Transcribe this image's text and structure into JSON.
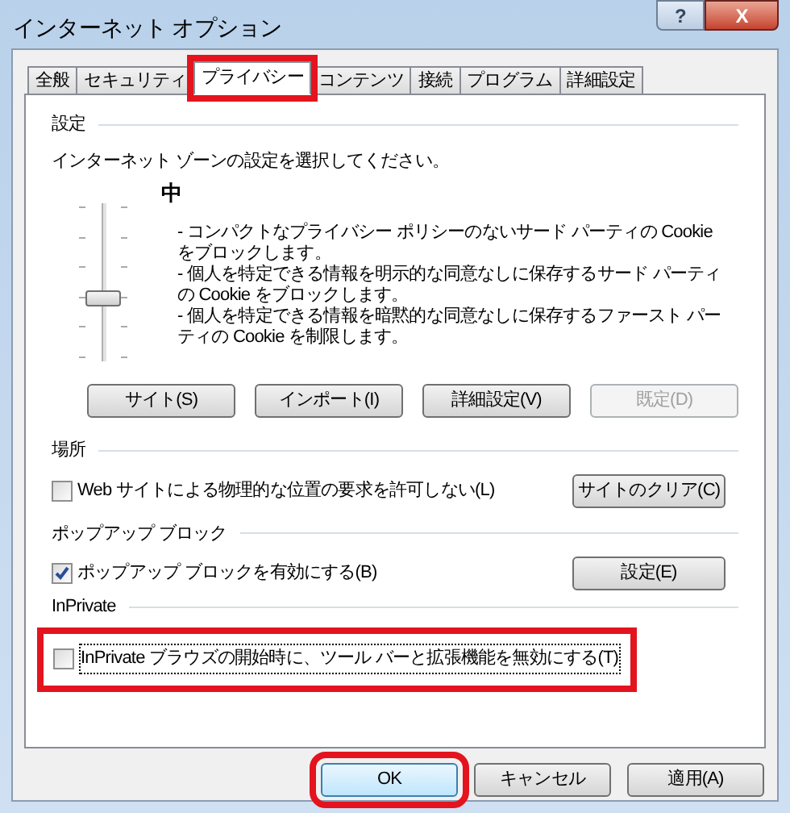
{
  "window": {
    "title": "インターネット オプション",
    "help": "?",
    "close": "X"
  },
  "tabs": [
    {
      "label": "全般",
      "selected": false,
      "highlighted": false
    },
    {
      "label": "セキュリティ",
      "selected": false,
      "highlighted": false
    },
    {
      "label": "プライバシー",
      "selected": true,
      "highlighted": true
    },
    {
      "label": "コンテンツ",
      "selected": false,
      "highlighted": false
    },
    {
      "label": "接続",
      "selected": false,
      "highlighted": false
    },
    {
      "label": "プログラム",
      "selected": false,
      "highlighted": false
    },
    {
      "label": "詳細設定",
      "selected": false,
      "highlighted": false
    }
  ],
  "settings": {
    "heading": "設定",
    "instruction": "インターネット ゾーンの設定を選択してください。",
    "level_name": "中",
    "slider": {
      "level": 0.4
    },
    "description": [
      "- コンパクトなプライバシー ポリシーのないサード パーティの Cookie をブロックします。",
      "- 個人を特定できる情報を明示的な同意なしに保存するサード パーティの Cookie をブロックします。",
      "- 個人を特定できる情報を暗黙的な同意なしに保存するファースト パーティの Cookie を制限します。"
    ],
    "buttons": [
      {
        "label": "サイト(S)",
        "disabled": false
      },
      {
        "label": "インポート(I)",
        "disabled": false
      },
      {
        "label": "詳細設定(V)",
        "disabled": false
      },
      {
        "label": "既定(D)",
        "disabled": true
      }
    ]
  },
  "location": {
    "heading": "場所",
    "checkbox": {
      "label": "Web サイトによる物理的な位置の要求を許可しない(L)",
      "checked": false
    },
    "button": "サイトのクリア(C)"
  },
  "popup_block": {
    "heading": "ポップアップ ブロック",
    "checkbox": {
      "label": "ポップアップ ブロックを有効にする(B)",
      "checked": true
    },
    "button": "設定(E)"
  },
  "inprivate": {
    "heading": "InPrivate",
    "checkbox": {
      "label": "InPrivate ブラウズの開始時に、ツール バーと拡張機能を無効にする(T)",
      "checked": false,
      "highlighted": true
    }
  },
  "dialog_buttons": [
    {
      "label": "OK",
      "highlighted": true
    },
    {
      "label": "キャンセル",
      "highlighted": false
    },
    {
      "label": "適用(A)",
      "highlighted": false
    }
  ]
}
